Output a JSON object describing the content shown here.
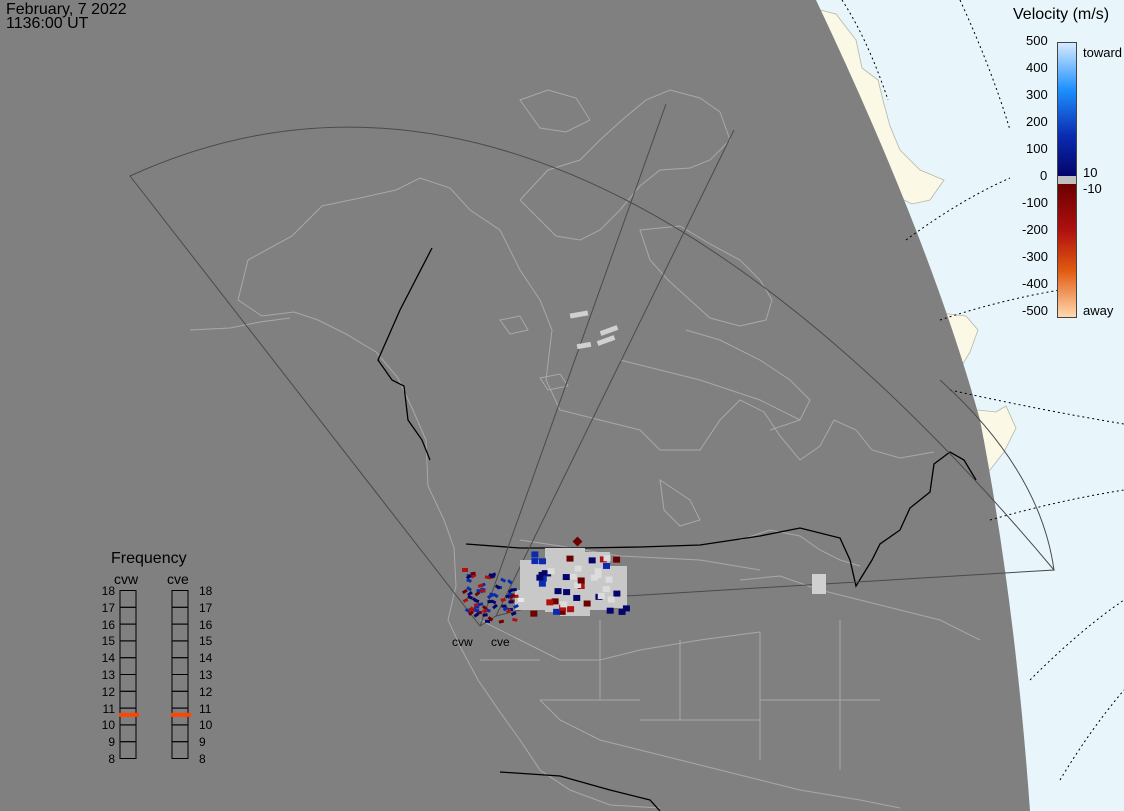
{
  "title": {
    "date": "February, 7 2022",
    "time": "1136:00 UT"
  },
  "velocity_legend": {
    "title": "Velocity (m/s)",
    "tick_labels": [
      "500",
      "400",
      "300",
      "200",
      "100",
      "10",
      "0",
      "-10",
      "-100",
      "-200",
      "-300",
      "-400",
      "-500"
    ],
    "toward_label": "toward",
    "away_label": "away",
    "colors": {
      "toward_high": "#d6ebff",
      "toward_mid": "#1e90ff",
      "toward_low": "#0a2bb0",
      "toward_min": "#04046b",
      "ground_scatter": "#bfbfbf",
      "away_min": "#6b0000",
      "away_low": "#b01010",
      "away_mid": "#e05a10",
      "away_high": "#ffd9b0"
    }
  },
  "frequency_panel": {
    "title": "Frequency",
    "radars": [
      {
        "label": "cvw",
        "frequency_mhz": 10.6
      },
      {
        "label": "cve",
        "frequency_mhz": 10.6
      }
    ],
    "scale": [
      "18",
      "17",
      "16",
      "15",
      "14",
      "13",
      "12",
      "11",
      "10",
      "9",
      "8"
    ],
    "marker_color": "#ff4500"
  },
  "map": {
    "radar_sites": [
      {
        "label": "cvw"
      },
      {
        "label": "cve"
      }
    ],
    "colors": {
      "night_side": "#808080",
      "day_ocean": "#e8f6fc",
      "day_land": "#fbf8e6",
      "coastline": "#a8a8a8",
      "border": "#000000",
      "fov_outline": "#4a4a4a",
      "grid_line": "#000000"
    }
  }
}
